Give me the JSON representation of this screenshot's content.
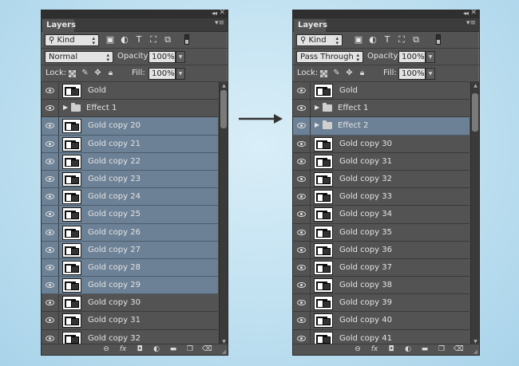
{
  "left_panel": {
    "title": "Layers",
    "filter": {
      "kind_label": "Kind",
      "search_glyph": "⚲"
    },
    "blend_mode": "Normal",
    "opacity_label": "Opacity:",
    "opacity_value": "100%",
    "lock_label": "Lock:",
    "fill_label": "Fill:",
    "fill_value": "100%",
    "layers": [
      {
        "name": "Gold",
        "type": "layer",
        "selected": false
      },
      {
        "name": "Effect 1",
        "type": "group",
        "selected": false
      },
      {
        "name": "Gold copy 20",
        "type": "layer",
        "selected": true
      },
      {
        "name": "Gold copy 21",
        "type": "layer",
        "selected": true
      },
      {
        "name": "Gold copy 22",
        "type": "layer",
        "selected": true
      },
      {
        "name": "Gold copy 23",
        "type": "layer",
        "selected": true
      },
      {
        "name": "Gold copy 24",
        "type": "layer",
        "selected": true
      },
      {
        "name": "Gold copy 25",
        "type": "layer",
        "selected": true
      },
      {
        "name": "Gold copy 26",
        "type": "layer",
        "selected": true
      },
      {
        "name": "Gold copy 27",
        "type": "layer",
        "selected": true
      },
      {
        "name": "Gold copy 28",
        "type": "layer",
        "selected": true
      },
      {
        "name": "Gold copy 29",
        "type": "layer",
        "selected": true
      },
      {
        "name": "Gold copy 30",
        "type": "layer",
        "selected": false
      },
      {
        "name": "Gold copy 31",
        "type": "layer",
        "selected": false
      },
      {
        "name": "Gold copy 32",
        "type": "layer",
        "selected": false
      }
    ]
  },
  "right_panel": {
    "title": "Layers",
    "filter": {
      "kind_label": "Kind",
      "search_glyph": "⚲"
    },
    "blend_mode": "Pass Through",
    "opacity_label": "Opacity:",
    "opacity_value": "100%",
    "lock_label": "Lock:",
    "fill_label": "Fill:",
    "fill_value": "100%",
    "layers": [
      {
        "name": "Gold",
        "type": "layer",
        "selected": false
      },
      {
        "name": "Effect 1",
        "type": "group",
        "selected": false
      },
      {
        "name": "Effect 2",
        "type": "group",
        "selected": true
      },
      {
        "name": "Gold copy 30",
        "type": "layer",
        "selected": false
      },
      {
        "name": "Gold copy 31",
        "type": "layer",
        "selected": false
      },
      {
        "name": "Gold copy 32",
        "type": "layer",
        "selected": false
      },
      {
        "name": "Gold copy 33",
        "type": "layer",
        "selected": false
      },
      {
        "name": "Gold copy 34",
        "type": "layer",
        "selected": false
      },
      {
        "name": "Gold copy 35",
        "type": "layer",
        "selected": false
      },
      {
        "name": "Gold copy 36",
        "type": "layer",
        "selected": false
      },
      {
        "name": "Gold copy 37",
        "type": "layer",
        "selected": false
      },
      {
        "name": "Gold copy 38",
        "type": "layer",
        "selected": false
      },
      {
        "name": "Gold copy 39",
        "type": "layer",
        "selected": false
      },
      {
        "name": "Gold copy 40",
        "type": "layer",
        "selected": false
      },
      {
        "name": "Gold copy 41",
        "type": "layer",
        "selected": false
      }
    ]
  },
  "footer_icons": [
    "link-icon",
    "fx-icon",
    "mask-icon",
    "adjustment-icon",
    "folder-icon",
    "new-layer-icon",
    "trash-icon"
  ],
  "footer_glyphs": {
    "link": "⊖",
    "fx": "fx",
    "mask": "◘",
    "adjustment": "◐",
    "folder": "▬",
    "new_layer": "❐",
    "trash": "🗑"
  },
  "colors": {
    "panel_bg": "#535353",
    "selected_row": "#6c8196",
    "background": "#bfe0f0",
    "arrow": "#333333"
  }
}
